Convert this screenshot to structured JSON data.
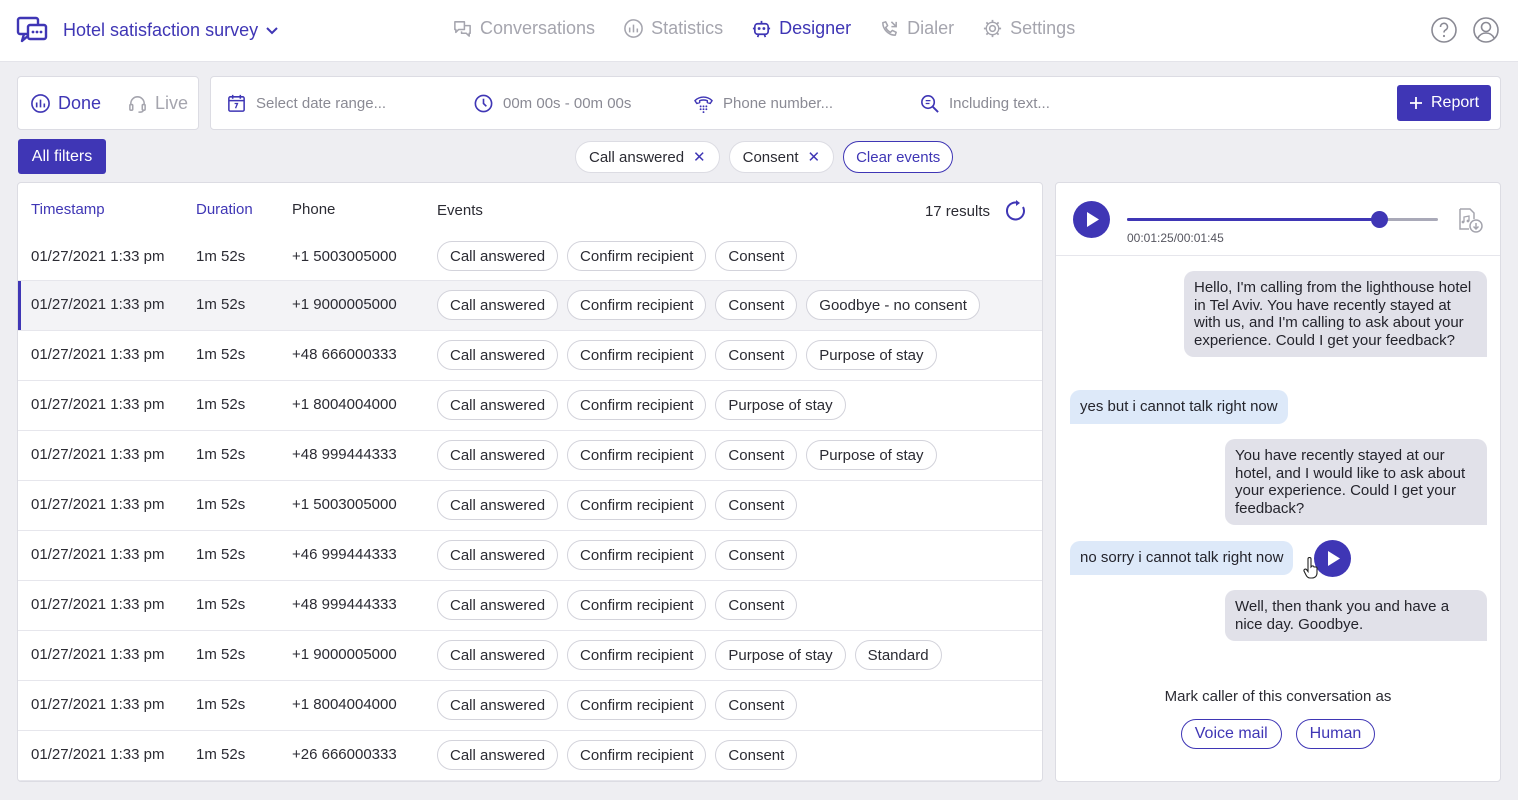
{
  "header": {
    "survey_title": "Hotel satisfaction survey",
    "nav": [
      {
        "label": "Conversations",
        "icon": "conversations-icon",
        "active": false
      },
      {
        "label": "Statistics",
        "icon": "statistics-icon",
        "active": false
      },
      {
        "label": "Designer",
        "icon": "designer-icon",
        "active": true
      },
      {
        "label": "Dialer",
        "icon": "dialer-icon",
        "active": false
      },
      {
        "label": "Settings",
        "icon": "gear-icon",
        "active": false
      }
    ],
    "right_icons": [
      "help-icon",
      "user-account-icon"
    ]
  },
  "modes": {
    "done_label": "Done",
    "live_label": "Live",
    "active": "Done"
  },
  "search": {
    "date_placeholder": "Select date range...",
    "duration_placeholder": "00m 00s - 00m 00s",
    "phone_placeholder": "Phone number...",
    "text_placeholder": "Including text...",
    "report_label": "Report"
  },
  "filters": {
    "all_filters_label": "All filters",
    "active": [
      "Call answered",
      "Consent"
    ],
    "clear_label": "Clear events"
  },
  "table": {
    "headers": {
      "timestamp": "Timestamp",
      "duration": "Duration",
      "phone": "Phone",
      "events": "Events"
    },
    "results_label": "17 results",
    "rows": [
      {
        "timestamp": "01/27/2021 1:33 pm",
        "duration": "1m 52s",
        "phone": "+1 5003005000",
        "events": [
          "Call answered",
          "Confirm recipient",
          "Consent"
        ]
      },
      {
        "timestamp": "01/27/2021 1:33 pm",
        "duration": "1m 52s",
        "phone": "+1 9000005000",
        "events": [
          "Call answered",
          "Confirm recipient",
          "Consent",
          "Goodbye - no consent"
        ],
        "selected": true
      },
      {
        "timestamp": "01/27/2021 1:33 pm",
        "duration": "1m 52s",
        "phone": "+48 666000333",
        "events": [
          "Call answered",
          "Confirm recipient",
          "Consent",
          "Purpose of stay"
        ]
      },
      {
        "timestamp": "01/27/2021 1:33 pm",
        "duration": "1m 52s",
        "phone": "+1 8004004000",
        "events": [
          "Call answered",
          "Confirm recipient",
          "Purpose of stay"
        ]
      },
      {
        "timestamp": "01/27/2021 1:33 pm",
        "duration": "1m 52s",
        "phone": "+48 999444333",
        "events": [
          "Call answered",
          "Confirm recipient",
          "Consent",
          "Purpose of stay"
        ]
      },
      {
        "timestamp": "01/27/2021 1:33 pm",
        "duration": "1m 52s",
        "phone": "+1 5003005000",
        "events": [
          "Call answered",
          "Confirm recipient",
          "Consent"
        ]
      },
      {
        "timestamp": "01/27/2021 1:33 pm",
        "duration": "1m 52s",
        "phone": "+46 999444333",
        "events": [
          "Call answered",
          "Confirm recipient",
          "Consent"
        ]
      },
      {
        "timestamp": "01/27/2021 1:33 pm",
        "duration": "1m 52s",
        "phone": "+48 999444333",
        "events": [
          "Call answered",
          "Confirm recipient",
          "Consent"
        ]
      },
      {
        "timestamp": "01/27/2021 1:33 pm",
        "duration": "1m 52s",
        "phone": "+1 9000005000",
        "events": [
          "Call answered",
          "Confirm recipient",
          "Purpose of stay",
          "Standard"
        ]
      },
      {
        "timestamp": "01/27/2021 1:33 pm",
        "duration": "1m 52s",
        "phone": "+1 8004004000",
        "events": [
          "Call answered",
          "Confirm recipient",
          "Consent"
        ]
      },
      {
        "timestamp": "01/27/2021 1:33 pm",
        "duration": "1m 52s",
        "phone": "+26 666000333",
        "events": [
          "Call answered",
          "Confirm recipient",
          "Consent"
        ]
      }
    ]
  },
  "player": {
    "time_label": "00:01:25/00:01:45",
    "progress": 0.81
  },
  "conversation": {
    "messages": [
      {
        "from": "bot",
        "text": "Hello, I'm calling from the lighthouse hotel in Tel Aviv. You have recently stayed at with us, and I'm calling to ask about your experience. Could I get your feedback?"
      },
      {
        "from": "user",
        "text": "yes but i cannot talk right now"
      },
      {
        "from": "bot",
        "text": "You have recently stayed at our hotel, and I would like to ask about your experience. Could I get your feedback?"
      },
      {
        "from": "user",
        "text": "no sorry i cannot talk right now"
      },
      {
        "from": "bot",
        "text": "Well, then thank you and have a nice day. Goodbye."
      }
    ],
    "mark_label": "Mark caller of this conversation as",
    "mark_options": [
      "Voice mail",
      "Human"
    ]
  },
  "colors": {
    "accent": "#3f36b5",
    "user_bubble": "#dde9f9",
    "bot_bubble": "#e1e1e9"
  }
}
